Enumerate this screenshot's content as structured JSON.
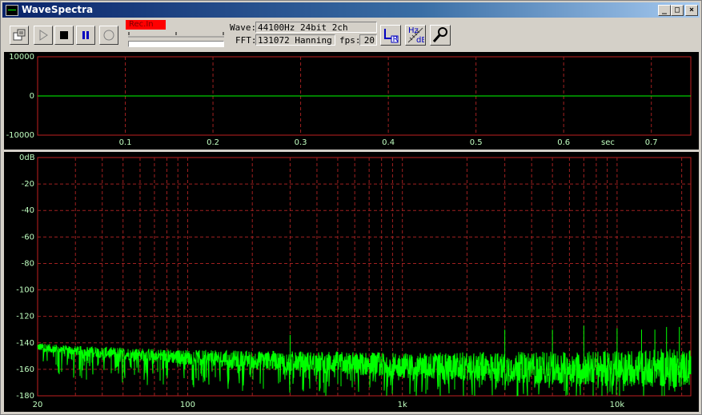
{
  "window": {
    "title": "WaveSpectra",
    "controls": [
      "_",
      "□",
      "×"
    ]
  },
  "toolbar": {
    "rec_in_label": "Rec.In",
    "wave_label": "Wave:",
    "wave_value": "44100Hz 24bit 2ch",
    "fft_label": "FFT:",
    "fft_value": "131072 Hanning",
    "fps_label": "fps:",
    "fps_value": "20",
    "icons": [
      "load-icon",
      "play-icon",
      "stop-icon",
      "pause-icon",
      "record-icon",
      "lr-channel-icon",
      "hz-db-icon",
      "settings-wrench-icon"
    ]
  },
  "colors": {
    "trace": "#00ff00",
    "grid": "#a02020",
    "frame": "#c02020",
    "axis_text": "#c0ffc0"
  },
  "waveform": {
    "y_ticks": [
      "10000",
      "0",
      "-10000"
    ],
    "x_ticks": [
      "0.1",
      "0.2",
      "0.3",
      "0.4",
      "0.5",
      "0.6",
      "0.7"
    ],
    "x_unit": "sec",
    "y_range": [
      -10000,
      10000
    ],
    "x_range": [
      0,
      0.745
    ]
  },
  "chart_data": {
    "type": "line",
    "x_scale": "log",
    "x_range": [
      20,
      22050
    ],
    "y_range": [
      -180,
      0
    ],
    "y_ticks": [
      "0dB",
      "-20",
      "-40",
      "-60",
      "-80",
      "-100",
      "-120",
      "-140",
      "-160",
      "-180"
    ],
    "x_ticks": [
      "20",
      "100",
      "1k",
      "10k"
    ],
    "series": [
      {
        "x": [
          20,
          30,
          50,
          100,
          200,
          500,
          1000,
          2000,
          5000,
          10000,
          20000
        ],
        "y": [
          -143,
          -146,
          -148,
          -151,
          -153,
          -155,
          -157,
          -158,
          -159,
          -159,
          -159
        ]
      }
    ],
    "spikes": [
      {
        "x": 300,
        "y": -134
      },
      {
        "x": 3000,
        "y": -130
      },
      {
        "x": 5000,
        "y": -130
      },
      {
        "x": 7000,
        "y": -127
      },
      {
        "x": 10000,
        "y": -129
      },
      {
        "x": 13000,
        "y": -130
      },
      {
        "x": 15000,
        "y": -130
      },
      {
        "x": 17000,
        "y": -128
      },
      {
        "x": 19500,
        "y": -128
      }
    ]
  }
}
